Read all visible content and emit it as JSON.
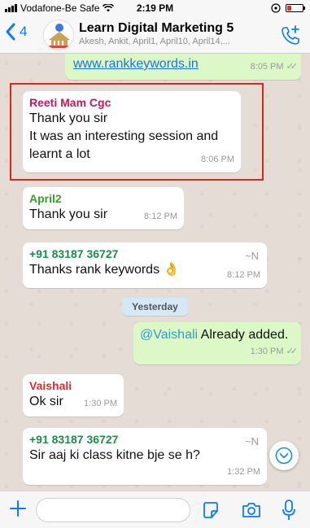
{
  "status_bar": {
    "carrier": "Vodafone-Be Safe",
    "time": "2:19 PM"
  },
  "header": {
    "back_count": "4",
    "group_name": "Learn Digital Marketing 5",
    "participants": "Akesh, Ankit, April1, April10, April14,..."
  },
  "messages": [
    {
      "type": "outgoing",
      "link": "www.rankkeywords.in",
      "time": "8:05 PM"
    },
    {
      "type": "incoming",
      "sender": "Reeti Mam Cgc",
      "sender_color": "#c2185b",
      "lines": [
        "Thank you sir",
        "It was an interesting session and",
        "learnt a lot"
      ],
      "time": "8:06 PM"
    },
    {
      "type": "incoming",
      "sender": "April2",
      "sender_color": "#3a9c2d",
      "text": "Thank you sir",
      "time": "8:12 PM"
    },
    {
      "type": "incoming",
      "sender": "+91 83187 36727",
      "sender_color": "#1e8a4b",
      "tilde": "~N",
      "text": "Thanks rank keywords",
      "emoji": "👌",
      "time": "8:12 PM"
    },
    {
      "type": "date",
      "label": "Yesterday"
    },
    {
      "type": "outgoing",
      "mention": "@Vaishali",
      "text": " Already added.",
      "time": "1:30 PM"
    },
    {
      "type": "incoming",
      "sender": "Vaishali",
      "sender_color": "#d32f2f",
      "text": "Ok sir",
      "time": "1:30 PM"
    },
    {
      "type": "incoming",
      "sender": "+91 83187 36727",
      "sender_color": "#1e8a4b",
      "tilde": "~N",
      "text": "Sir aaj ki class kitne bje se h?",
      "time": "1:32 PM"
    }
  ],
  "input": {
    "placeholder": ""
  },
  "colors": {
    "accent": "#0a7aff",
    "outgoing_bubble": "#dcf8c6",
    "highlight_box": "#d8281e"
  }
}
